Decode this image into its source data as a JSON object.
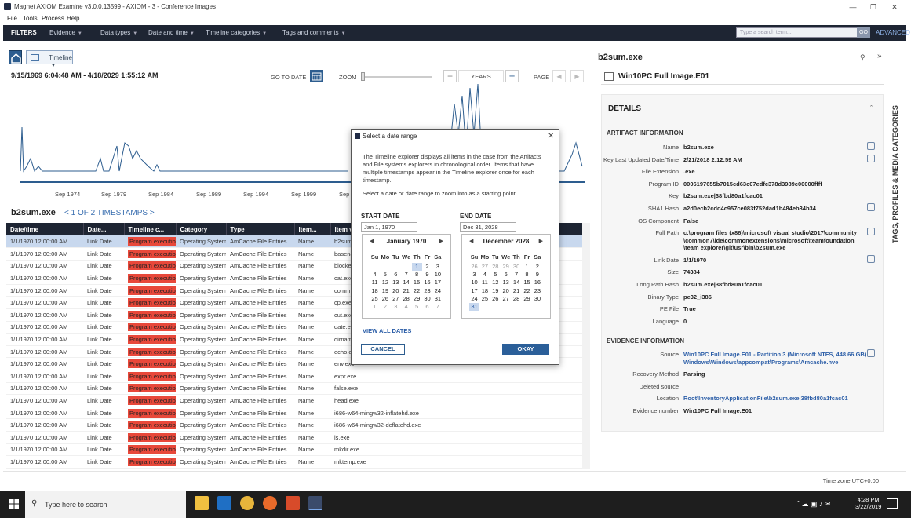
{
  "window": {
    "title": "Magnet AXIOM Examine v3.0.0.13599 - AXIOM - 3 - Conference Images"
  },
  "menu": [
    "File",
    "Tools",
    "Process",
    "Help"
  ],
  "filters": {
    "label": "FILTERS",
    "items": [
      "Evidence",
      "Data types",
      "Date and time",
      "Timeline categories",
      "Tags and comments"
    ],
    "search_placeholder": "Type a search term...",
    "go": "GO",
    "advanced": "ADVANCED"
  },
  "timeline": {
    "view_label": "Timeline",
    "range": "9/15/1969 6:04:48 AM  -  4/18/2029 1:55:12 AM",
    "go_to_date": "GO TO DATE",
    "zoom": "ZOOM",
    "zoom_minus": "−",
    "zoom_unit": "YEARS",
    "zoom_plus": "+",
    "page": "PAGE",
    "page_prev": "◀",
    "page_next": "▶"
  },
  "chart_data": {
    "type": "line",
    "x_tick_labels": [
      "Sep 1974",
      "Sep 1979",
      "Sep 1984",
      "Sep 1989",
      "Sep 1994",
      "Sep 1999",
      "Sep"
    ]
  },
  "timestamps": {
    "name": "b2sum.exe",
    "nav": "<  1 OF 2 TIMESTAMPS  >"
  },
  "grid": {
    "columns": [
      "Date/time",
      "Date...",
      "Timeline c...",
      "Category",
      "Type",
      "Item...",
      "Item valu"
    ],
    "rows": [
      [
        "1/1/1970 12:00:00 AM",
        "Link Date",
        "Program execution",
        "Operating System",
        "AmCache File Entries",
        "Name",
        "b2sum.exe"
      ],
      [
        "1/1/1970 12:00:00 AM",
        "Link Date",
        "Program execution",
        "Operating System",
        "AmCache File Entries",
        "Name",
        "basename"
      ],
      [
        "1/1/1970 12:00:00 AM",
        "Link Date",
        "Program execution",
        "Operating System",
        "AmCache File Entries",
        "Name",
        "blocked-fi"
      ],
      [
        "1/1/1970 12:00:00 AM",
        "Link Date",
        "Program execution",
        "Operating System",
        "AmCache File Entries",
        "Name",
        "cat.exe"
      ],
      [
        "1/1/1970 12:00:00 AM",
        "Link Date",
        "Program execution",
        "Operating System",
        "AmCache File Entries",
        "Name",
        "comm.exe"
      ],
      [
        "1/1/1970 12:00:00 AM",
        "Link Date",
        "Program execution",
        "Operating System",
        "AmCache File Entries",
        "Name",
        "cp.exe"
      ],
      [
        "1/1/1970 12:00:00 AM",
        "Link Date",
        "Program execution",
        "Operating System",
        "AmCache File Entries",
        "Name",
        "cut.exe"
      ],
      [
        "1/1/1970 12:00:00 AM",
        "Link Date",
        "Program execution",
        "Operating System",
        "AmCache File Entries",
        "Name",
        "date.exe"
      ],
      [
        "1/1/1970 12:00:00 AM",
        "Link Date",
        "Program execution",
        "Operating System",
        "AmCache File Entries",
        "Name",
        "dirname.e"
      ],
      [
        "1/1/1970 12:00:00 AM",
        "Link Date",
        "Program execution",
        "Operating System",
        "AmCache File Entries",
        "Name",
        "echo.exe"
      ],
      [
        "1/1/1970 12:00:00 AM",
        "Link Date",
        "Program execution",
        "Operating System",
        "AmCache File Entries",
        "Name",
        "env.exe"
      ],
      [
        "1/1/1970 12:00:00 AM",
        "Link Date",
        "Program execution",
        "Operating System",
        "AmCache File Entries",
        "Name",
        "expr.exe"
      ],
      [
        "1/1/1970 12:00:00 AM",
        "Link Date",
        "Program execution",
        "Operating System",
        "AmCache File Entries",
        "Name",
        "false.exe"
      ],
      [
        "1/1/1970 12:00:00 AM",
        "Link Date",
        "Program execution",
        "Operating System",
        "AmCache File Entries",
        "Name",
        "head.exe"
      ],
      [
        "1/1/1970 12:00:00 AM",
        "Link Date",
        "Program execution",
        "Operating System",
        "AmCache File Entries",
        "Name",
        "i686-w64-mingw32-inflatehd.exe"
      ],
      [
        "1/1/1970 12:00:00 AM",
        "Link Date",
        "Program execution",
        "Operating System",
        "AmCache File Entries",
        "Name",
        "i686-w64-mingw32-deflatehd.exe"
      ],
      [
        "1/1/1970 12:00:00 AM",
        "Link Date",
        "Program execution",
        "Operating System",
        "AmCache File Entries",
        "Name",
        "ls.exe"
      ],
      [
        "1/1/1970 12:00:00 AM",
        "Link Date",
        "Program execution",
        "Operating System",
        "AmCache File Entries",
        "Name",
        "mkdir.exe"
      ],
      [
        "1/1/1970 12:00:00 AM",
        "Link Date",
        "Program execution",
        "Operating System",
        "AmCache File Entries",
        "Name",
        "mktemp.exe"
      ]
    ]
  },
  "details": {
    "title": "b2sum.exe",
    "source_file": "Win10PC Full Image.E01",
    "header": "DETAILS",
    "artifact_section": "ARTIFACT INFORMATION",
    "artifact": [
      [
        "Name",
        "b2sum.exe"
      ],
      [
        "Key Last Updated Date/Time",
        "2/21/2018 2:12:59 AM"
      ],
      [
        "File Extension",
        ".exe"
      ],
      [
        "Program ID",
        "0006197655b7015cd63c07edfc378d3989c00000ffff"
      ],
      [
        "Key",
        "b2sum.exe|38fbd80a1fcac01"
      ],
      [
        "SHA1 Hash",
        "a2d0ecb2cdd4c957ce083f752dad1b484eb34b34"
      ],
      [
        "OS Component",
        "False"
      ],
      [
        "Full Path",
        "c:\\program files (x86)\\microsoft visual studio\\2017\\community"
      ],
      [
        "",
        "\\common7\\ide\\commonextensions\\microsoft\\teamfoundation"
      ],
      [
        "",
        "\\team explorer\\git\\usr\\bin\\b2sum.exe"
      ],
      [
        "Link Date",
        "1/1/1970"
      ],
      [
        "Size",
        "74384"
      ],
      [
        "Long Path Hash",
        "b2sum.exe|38fbd80a1fcac01"
      ],
      [
        "Binary Type",
        "pe32_i386"
      ],
      [
        "PE File",
        "True"
      ],
      [
        "Language",
        "0"
      ]
    ],
    "evidence_section": "EVIDENCE INFORMATION",
    "evidence": [
      [
        "Source",
        "Win10PC Full Image.E01 - Partition 3 (Microsoft NTFS, 448.66 GB)"
      ],
      [
        "",
        "Windows\\Windows\\appcompat\\Programs\\Amcache.hve"
      ],
      [
        "Recovery Method",
        "Parsing"
      ],
      [
        "Deleted source",
        ""
      ],
      [
        "Location",
        "Root\\InventoryApplicationFile\\b2sum.exe|38fbd80a1fcac01"
      ],
      [
        "Evidence number",
        "Win10PC Full Image.E01"
      ]
    ]
  },
  "sidetab": "TAGS, PROFILES & MEDIA CATEGORIES",
  "timezone": "Time zone    UTC+0:00",
  "taskbar": {
    "search": "Type here to search",
    "time": "4:28 PM",
    "date": "3/22/2019"
  },
  "dialog": {
    "title": "Select a date range",
    "close": "✕",
    "description": "The Timeline explorer displays all items in the case from the Artifacts and File systems explorers in chronological order. Items that have multiple timestamps appear in the Timeline explorer once for each timestamp.",
    "instruction": "Select a date or date range to zoom into as a starting point.",
    "start_label": "START DATE",
    "start_value": "Jan 1, 1970",
    "end_label": "END DATE",
    "end_value": "Dec 31, 2028",
    "start_month": "January 1970",
    "end_month": "December 2028",
    "dow": [
      "Su",
      "Mo",
      "Tu",
      "We",
      "Th",
      "Fr",
      "Sa"
    ],
    "view_all": "VIEW ALL DATES",
    "cancel": "CANCEL",
    "okay": "OKAY"
  }
}
